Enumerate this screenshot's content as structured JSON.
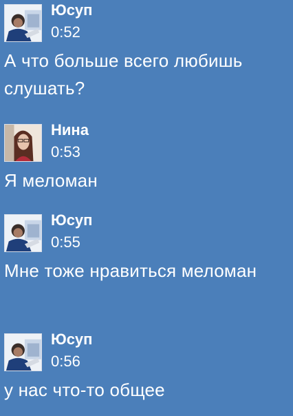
{
  "messages": [
    {
      "author": "Юсуп",
      "time": "0:52",
      "text": "А что больше всего любишь слушать?",
      "avatar": "male-avatar"
    },
    {
      "author": "Нина",
      "time": "0:53",
      "text": "Я меломан",
      "avatar": "female-avatar"
    },
    {
      "author": "Юсуп",
      "time": "0:55",
      "text": "Мне тоже нравиться меломан",
      "avatar": "male-avatar"
    },
    {
      "author": "Юсуп",
      "time": "0:56",
      "text": "у нас что-то общее",
      "avatar": "male-avatar"
    }
  ],
  "colors": {
    "background": "#4b7fba",
    "text": "#ffffff"
  }
}
